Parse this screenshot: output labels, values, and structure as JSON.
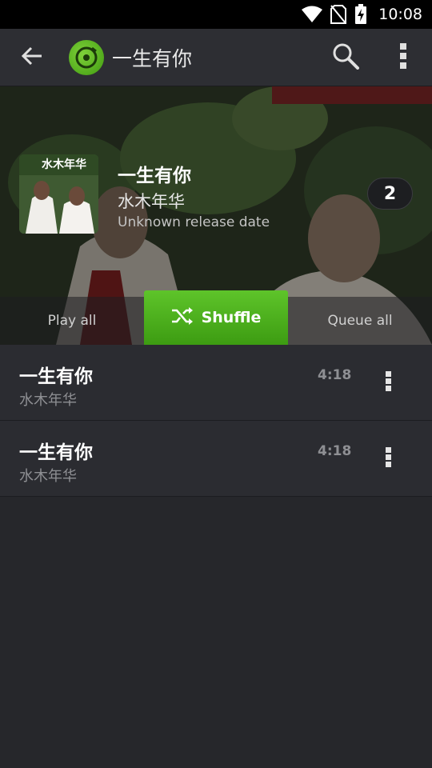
{
  "status_bar": {
    "time": "10:08",
    "icons": [
      "wifi-icon",
      "no-sim-icon",
      "battery-charging-icon"
    ]
  },
  "toolbar": {
    "back_icon": "arrow-left-icon",
    "app_icon": "music-disc-icon",
    "title": "一生有你",
    "search_icon": "search-icon",
    "overflow_icon": "more-vert-icon"
  },
  "album": {
    "art_text": "水木年华",
    "title": "一生有你",
    "artist": "水木年华",
    "release_date": "Unknown release date",
    "track_count": "2"
  },
  "actions": {
    "play_all": "Play all",
    "shuffle": "Shuffle",
    "shuffle_icon": "shuffle-icon",
    "queue_all": "Queue all"
  },
  "tracks": [
    {
      "title": "一生有你",
      "artist": "水木年华",
      "duration": "4:18"
    },
    {
      "title": "一生有你",
      "artist": "水木年华",
      "duration": "4:18"
    }
  ],
  "colors": {
    "accent": "#4fb01d",
    "background": "#26272b",
    "toolbar": "#2d2e33"
  }
}
